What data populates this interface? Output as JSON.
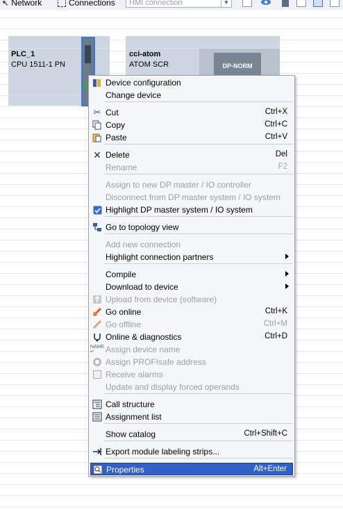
{
  "toolbar": {
    "network_label": "Network",
    "connections_label": "Connections",
    "hmi_connection_value": "HMI connection"
  },
  "devices": [
    {
      "name": "PLC_1",
      "type": "CPU 1511-1 PN"
    },
    {
      "name": "cci-atom",
      "type": "ATOM SCR",
      "tag": "DP-NORM"
    }
  ],
  "menu": {
    "items": [
      {
        "label": "Device configuration",
        "shortcut": "",
        "icon": "device-config-icon"
      },
      {
        "label": "Change device",
        "shortcut": ""
      },
      {
        "label": "Cut",
        "shortcut": "Ctrl+X",
        "icon": "scissors-icon"
      },
      {
        "label": "Copy",
        "shortcut": "Ctrl+C",
        "icon": "copy-icon"
      },
      {
        "label": "Paste",
        "shortcut": "Ctrl+V",
        "icon": "paste-icon"
      },
      {
        "label": "Delete",
        "shortcut": "Del",
        "icon": "delete-x-icon"
      },
      {
        "label": "Rename",
        "shortcut": "F2",
        "disabled": true
      },
      {
        "label": "Assign to new DP master / IO controller",
        "disabled": true
      },
      {
        "label": "Disconnect from DP master system / IO system",
        "disabled": true
      },
      {
        "label": "Highlight DP master system / IO system",
        "checked": true
      },
      {
        "label": "Go to topology view",
        "icon": "topology-icon"
      },
      {
        "label": "Add new connection",
        "disabled": true
      },
      {
        "label": "Highlight connection partners",
        "submenu": true
      },
      {
        "label": "Compile",
        "submenu": true
      },
      {
        "label": "Download to device",
        "submenu": true
      },
      {
        "label": "Upload from device (software)",
        "disabled": true,
        "icon": "upload-icon"
      },
      {
        "label": "Go online",
        "shortcut": "Ctrl+K",
        "icon": "go-online-icon"
      },
      {
        "label": "Go offline",
        "shortcut": "Ctrl+M",
        "disabled": true,
        "icon": "go-offline-icon"
      },
      {
        "label": "Online & diagnostics",
        "shortcut": "Ctrl+D",
        "icon": "diagnostics-icon"
      },
      {
        "label": "Assign device name",
        "disabled": true,
        "icon": "name-icon"
      },
      {
        "label": "Assign PROFIsafe address",
        "disabled": true,
        "icon": "profisafe-icon"
      },
      {
        "label": "Receive alarms",
        "disabled": true
      },
      {
        "label": "Update and display forced operands",
        "disabled": true
      },
      {
        "label": "Call structure",
        "icon": "call-structure-icon"
      },
      {
        "label": "Assignment list",
        "icon": "assignment-list-icon"
      },
      {
        "label": "Show catalog",
        "shortcut": "Ctrl+Shift+C"
      },
      {
        "label": "Export module labeling strips...",
        "icon": "export-arrow-icon"
      },
      {
        "label": "Properties",
        "shortcut": "Alt+Enter",
        "icon": "properties-icon",
        "selected": true
      }
    ]
  }
}
